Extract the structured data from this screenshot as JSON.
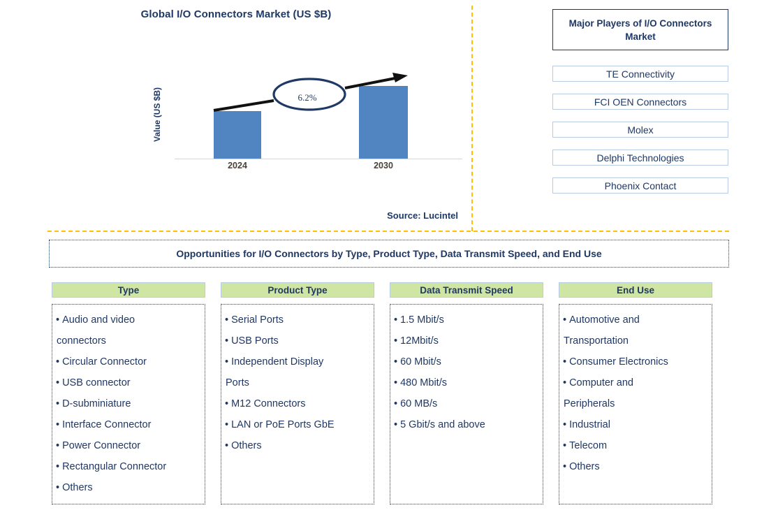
{
  "chart_panel": {
    "title": "Global I/O Connectors Market (US $B)",
    "y_axis_label": "Value (US $B)",
    "source": "Source: Lucintel"
  },
  "chart_data": {
    "type": "bar",
    "title": "Global I/O Connectors Market (US $B)",
    "xlabel": "",
    "ylabel": "Value (US $B)",
    "categories": [
      "2024",
      "2030"
    ],
    "values": [
      68,
      104
    ],
    "value_unit": "relative bar height (US $B, unlabeled axis)",
    "grid": false,
    "legend": false,
    "annotations": [
      {
        "text": "6.2%",
        "kind": "cagr-callout",
        "from_category": "2024",
        "to_category": "2030"
      }
    ],
    "bar_color": "#5085C1"
  },
  "players_panel": {
    "header": "Major Players of I/O Connectors Market",
    "items": [
      "TE Connectivity",
      "FCI OEN Connectors",
      "Molex",
      "Delphi Technologies",
      "Phoenix Contact"
    ]
  },
  "opportunities": {
    "banner": "Opportunities for I/O Connectors by Type, Product Type, Data Transmit Speed, and End Use",
    "columns": [
      {
        "header": "Type",
        "items": [
          "Audio and video\nconnectors",
          "Circular Connector",
          "USB connector",
          "D-subminiature",
          "Interface Connector",
          "Power Connector",
          "Rectangular Connector",
          "Others"
        ]
      },
      {
        "header": "Product Type",
        "items": [
          "Serial Ports",
          "USB Ports",
          "Independent Display\nPorts",
          "M12 Connectors",
          "LAN or PoE Ports GbE",
          "Others"
        ]
      },
      {
        "header": "Data Transmit Speed",
        "items": [
          "1.5 Mbit/s",
          "12Mbit/s",
          "60 Mbit/s",
          "480 Mbit/s",
          "60 MB/s",
          "5 Gbit/s and above"
        ]
      },
      {
        "header": "End Use",
        "items": [
          "Automotive and\nTransportation",
          "Consumer Electronics",
          "Computer and\nPeripherals",
          "Industrial",
          "Telecom",
          "Others"
        ]
      }
    ]
  },
  "colors": {
    "navy": "#1F3864",
    "bar_blue": "#5085C1",
    "header_green": "#CFE5A3",
    "divider_orange": "#FFC000",
    "box_border_blue": "#b8cce4"
  }
}
